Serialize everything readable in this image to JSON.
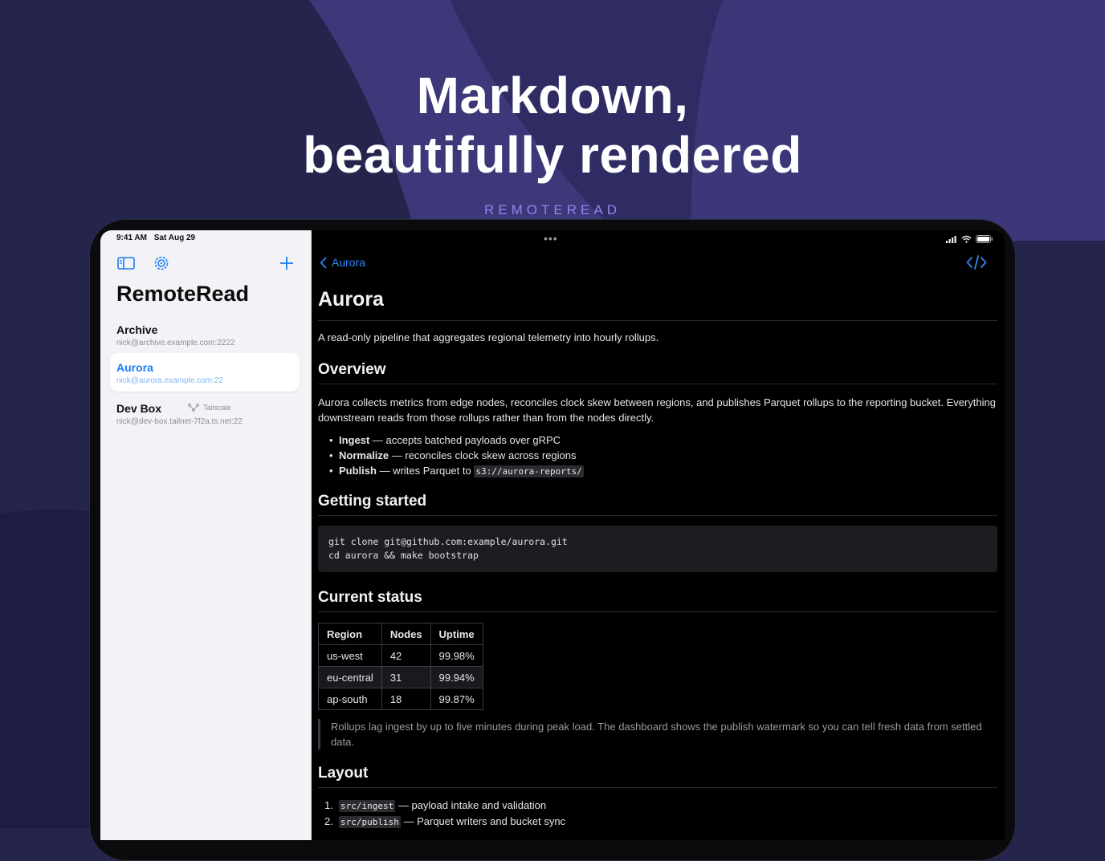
{
  "hero": {
    "line1": "Markdown,",
    "line2": "beautifully rendered",
    "brand": "REMOTEREAD"
  },
  "colors": {
    "accent": "#1a7cf5",
    "background": "#25244d",
    "brand": "#8f86ea"
  },
  "status_bar": {
    "time": "9:41 AM",
    "date": "Sat Aug 29"
  },
  "sidebar": {
    "toolbar": {
      "toggle_icon": "sidebar-toggle-icon",
      "settings_icon": "gear-icon",
      "add_icon": "plus-icon"
    },
    "title": "RemoteRead",
    "servers": [
      {
        "name": "Archive",
        "address": "nick@archive.example.com:2222",
        "tag": "",
        "selected": false
      },
      {
        "name": "Aurora",
        "address": "nick@aurora.example.com:22",
        "tag": "",
        "selected": true
      },
      {
        "name": "Dev Box",
        "address": "nick@dev-box.tailnet-7f2a.ts.net:22",
        "tag": "Tailscale",
        "selected": false
      }
    ]
  },
  "detail": {
    "back_label": "Aurora",
    "code_toggle_icon": "code-icon",
    "doc": {
      "h1": "Aurora",
      "intro": "A read-only pipeline that aggregates regional telemetry into hourly rollups.",
      "overview": {
        "heading": "Overview",
        "text": "Aurora collects metrics from edge nodes, reconciles clock skew between regions, and publishes Parquet rollups to the reporting bucket. Everything downstream reads from those rollups rather than from the nodes directly.",
        "bullets": [
          {
            "term": "Ingest",
            "text": " — accepts batched payloads over gRPC",
            "code": ""
          },
          {
            "term": "Normalize",
            "text": " — reconciles clock skew across regions",
            "code": ""
          },
          {
            "term": "Publish",
            "text": " — writes Parquet to ",
            "code": "s3://aurora-reports/"
          }
        ]
      },
      "getting_started": {
        "heading": "Getting started",
        "code": "git clone git@github.com:example/aurora.git\ncd aurora && make bootstrap"
      },
      "current_status": {
        "heading": "Current status",
        "columns": [
          "Region",
          "Nodes",
          "Uptime"
        ],
        "rows": [
          [
            "us-west",
            "42",
            "99.98%"
          ],
          [
            "eu-central",
            "31",
            "99.94%"
          ],
          [
            "ap-south",
            "18",
            "99.87%"
          ]
        ],
        "note": "Rollups lag ingest by up to five minutes during peak load. The dashboard shows the publish watermark so you can tell fresh data from settled data."
      },
      "layout": {
        "heading": "Layout",
        "items": [
          {
            "num": "1.",
            "code": "src/ingest",
            "text": " — payload intake and validation"
          },
          {
            "num": "2.",
            "code": "src/publish",
            "text": " — Parquet writers and bucket sync"
          }
        ]
      }
    }
  }
}
